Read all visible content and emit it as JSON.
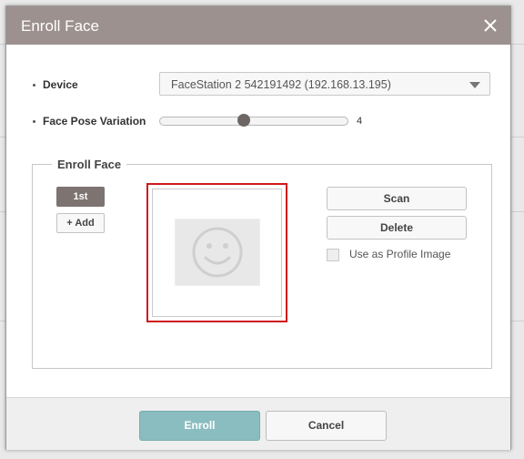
{
  "dialog": {
    "title": "Enroll Face",
    "close_icon": "close-icon"
  },
  "form": {
    "device": {
      "label": "Device",
      "selected": "FaceStation 2 542191492 (192.168.13.195)"
    },
    "pose": {
      "label": "Face Pose Variation",
      "value": "4",
      "level_fraction": 0.45
    }
  },
  "enroll_section": {
    "legend": "Enroll Face",
    "tabs": [
      "1st"
    ],
    "add_label": "+ Add",
    "scan_label": "Scan",
    "delete_label": "Delete",
    "profile_checkbox_label": "Use as Profile Image",
    "profile_checked": false,
    "placeholder_icon": "smiley-face-icon"
  },
  "footer": {
    "enroll_label": "Enroll",
    "cancel_label": "Cancel"
  },
  "colors": {
    "titlebar": "#9c918f",
    "accent": "#8abdc0",
    "selection_border": "#d0181c",
    "tab_active": "#7d7371"
  }
}
